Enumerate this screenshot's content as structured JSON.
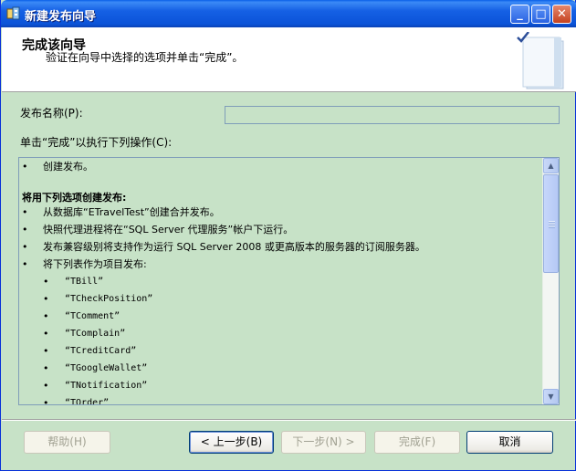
{
  "window": {
    "title": "新建发布向导",
    "minimize_glyph": "_",
    "maximize_glyph": "□",
    "close_glyph": "✕"
  },
  "header": {
    "title": "完成该向导",
    "subtitle": "验证在向导中选择的选项并单击“完成”。"
  },
  "form": {
    "publication_name_label": "发布名称(P):",
    "publication_name_value": "",
    "actions_label": "单击“完成”以执行下列操作(C):"
  },
  "actions": {
    "bullet": "•",
    "line_create": "创建发布。",
    "section_title": "将用下列选项创建发布:",
    "items": [
      "从数据库“ETravelTest”创建合并发布。",
      "快照代理进程将在“SQL Server 代理服务”帐户下运行。",
      "发布兼容级别将支持作为运行 SQL Server 2008 或更高版本的服务器的订阅服务器。",
      "将下列表作为项目发布:"
    ],
    "tables": [
      "“TBill”",
      "“TCheckPosition”",
      "“TComment”",
      "“TComplain”",
      "“TCreditCard”",
      "“TGoogleWallet”",
      "“TNotification”",
      "“TOrder”"
    ]
  },
  "buttons": {
    "help": "帮助(H)",
    "back": "< 上一步(B)",
    "next": "下一步(N) >",
    "finish": "完成(F)",
    "cancel": "取消"
  },
  "icons": {
    "app": "wizard-app-icon",
    "header_art": "book-check-icon",
    "scroll_up": "▲",
    "scroll_down": "▼"
  },
  "colors": {
    "title_bar": "#0b53d8",
    "body_background": "#c7e2c7",
    "header_background": "#ffffff"
  }
}
